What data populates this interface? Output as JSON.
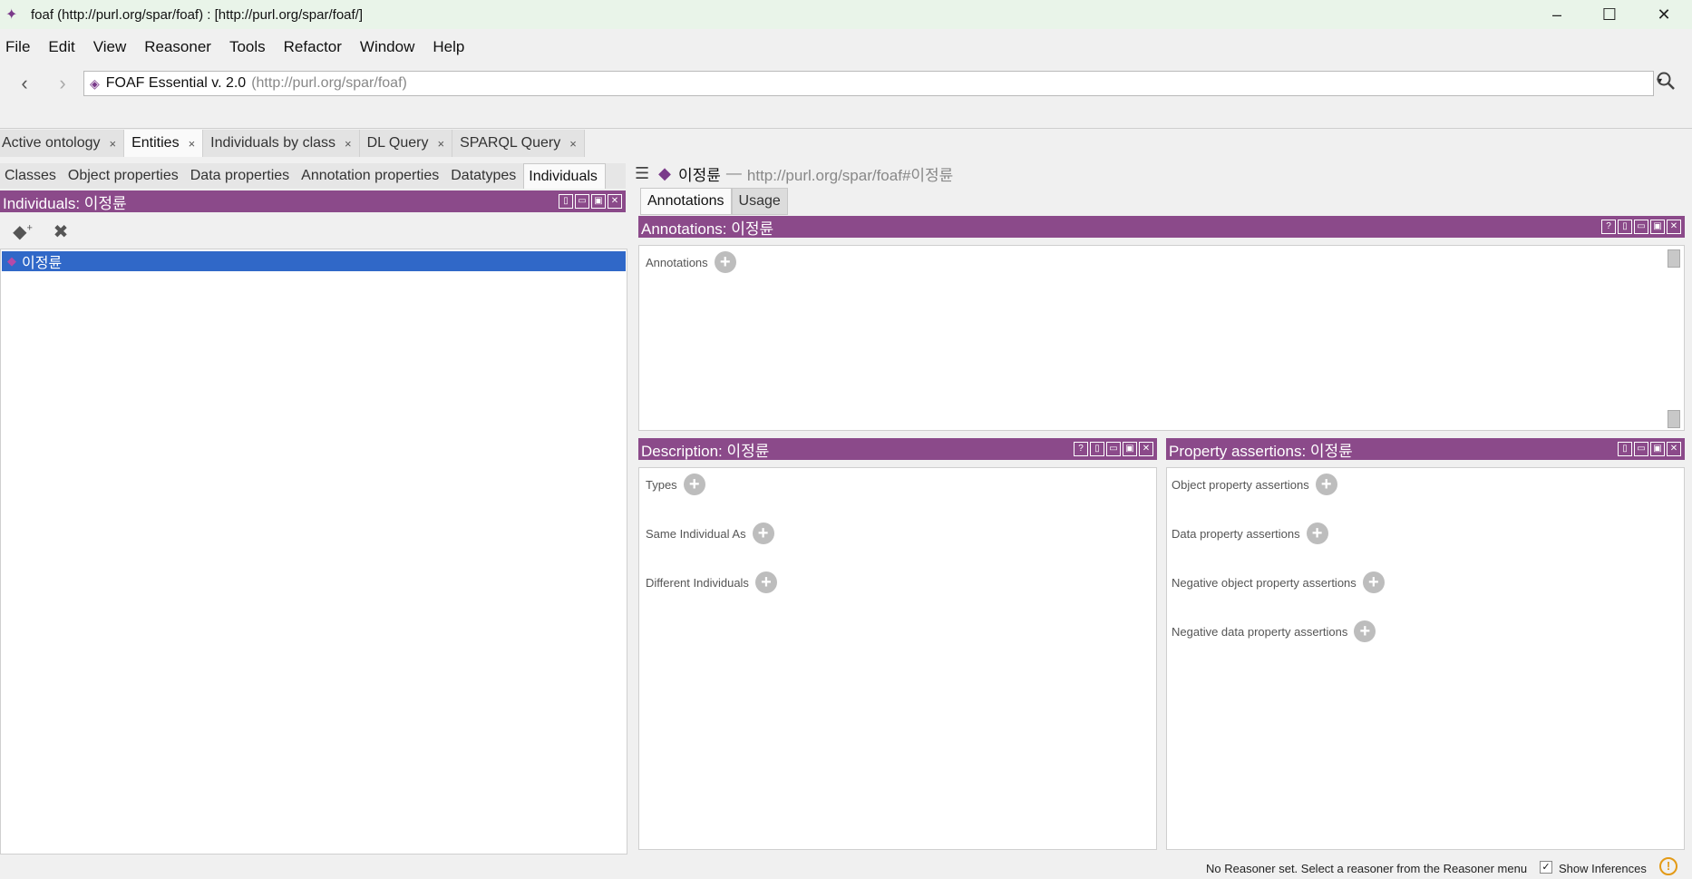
{
  "window": {
    "title": "foaf (http://purl.org/spar/foaf)  : [http://purl.org/spar/foaf/]",
    "minimize": "–",
    "maximize": "☐",
    "close": "✕"
  },
  "menu": [
    "File",
    "Edit",
    "View",
    "Reasoner",
    "Tools",
    "Refactor",
    "Window",
    "Help"
  ],
  "nav": {
    "back": "‹",
    "forward": "›",
    "ontology_name": "FOAF Essential v. 2.0",
    "ontology_uri": "(http://purl.org/spar/foaf)",
    "dropdown": "▾",
    "search_icon": "search-icon"
  },
  "tabs": [
    {
      "label": "Active ontology",
      "close": "×"
    },
    {
      "label": "Entities",
      "close": "×",
      "active": true
    },
    {
      "label": "Individuals by class",
      "close": "×"
    },
    {
      "label": "DL Query",
      "close": "×"
    },
    {
      "label": "SPARQL Query",
      "close": "×"
    }
  ],
  "subtabs": [
    "Classes",
    "Object properties",
    "Data properties",
    "Annotation properties",
    "Datatypes",
    "Individuals"
  ],
  "individuals_panel": {
    "title": "Individuals: 이정륜",
    "selected_item": "이정륜",
    "tools": [
      "add-individual-icon",
      "delete-individual-icon"
    ]
  },
  "entity": {
    "name": "이정륜",
    "separator": "—",
    "uri": "http://purl.org/spar/foaf#이정륜"
  },
  "right_tabs": [
    "Annotations",
    "Usage"
  ],
  "annotations_panel": {
    "title": "Annotations: 이정륜",
    "sections": [
      "Annotations"
    ]
  },
  "description_panel": {
    "title": "Description: 이정륜",
    "sections": [
      "Types",
      "Same Individual As",
      "Different Individuals"
    ]
  },
  "property_panel": {
    "title": "Property assertions: 이정륜",
    "sections": [
      "Object property assertions",
      "Data property assertions",
      "Negative object property assertions",
      "Negative data property assertions"
    ]
  },
  "status": {
    "message": "No Reasoner set. Select a reasoner from the Reasoner menu",
    "show_inferences": "Show Inferences",
    "check": "✓",
    "warn": "!"
  },
  "colors": {
    "panel_header": "#8b4a8a",
    "selection": "#3068c8",
    "titlebar": "#e9f4e9"
  }
}
